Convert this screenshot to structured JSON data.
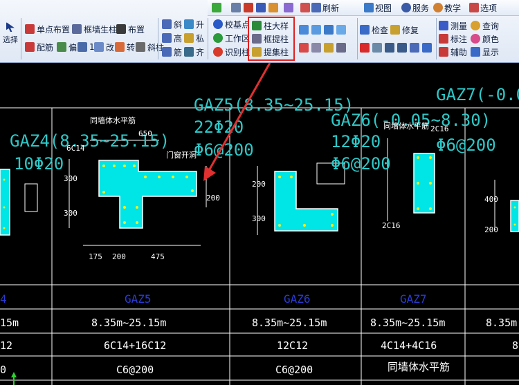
{
  "toolbar_top": {
    "refresh": "刷新",
    "view": "视图",
    "service": "服务",
    "teach": "教学",
    "options": "选项"
  },
  "ribbon": {
    "select": "选择",
    "single_point": "单点布置",
    "frame_wall_col": "框墙生柱",
    "place": "布置",
    "rebar_config": "配筋",
    "offset": "偏",
    "length_short": "1",
    "change": "改",
    "turn": "转",
    "slant_col": "斜柱",
    "slant": "斜",
    "up": "升",
    "height": "高",
    "private": "私",
    "rebar": "筋",
    "align": "齐",
    "check_base": "校基点",
    "work_zone": "工作区",
    "identify_col": "识别柱",
    "col_detail": "柱大样",
    "frame_extract_col": "框提柱",
    "extract_set": "提集柱",
    "check": "检查",
    "repair": "修复",
    "measure": "测量",
    "query": "查询",
    "annotate_col": "标注",
    "color": "颜色",
    "aux": "辅助",
    "display": "显示"
  },
  "drawing": {
    "labels_gaz": [
      "GAZ4(8.35~25.15)",
      "GAZ5(8.35~25.15)",
      "GAZ6(-0.05~8.30)",
      "GAZ7(-0.0"
    ],
    "rebar_main": [
      "10Φ20",
      "22Φ20",
      "12Φ20",
      "Φ6@200",
      "Φ6@200",
      "Φ6@200"
    ],
    "notes": [
      "同墙体水平筋",
      "门窗开洞",
      "同墙体水平筋"
    ],
    "dims": [
      "650",
      "300",
      "300",
      "200",
      "175",
      "200",
      "475",
      "200",
      "300",
      "6C14",
      "2C16",
      "2C16",
      "400",
      "200"
    ],
    "table": {
      "headers": [
        "4",
        "GAZ5",
        "GAZ6",
        "GAZ7"
      ],
      "elevation": [
        "15m",
        "8.35m~25.15m",
        "8.35m~25.15m",
        "8.35m~25.15m",
        "8.35m"
      ],
      "longitudinal": [
        "12",
        "6C14+16C12",
        "12C12",
        "4C14+4C16",
        "8"
      ],
      "stirrup": [
        "0",
        "C6@200",
        "C6@200",
        "同墙体水平筋"
      ]
    }
  },
  "colors": {
    "cyan_label": "#2ec8c8",
    "column_fill": "#00e5e5",
    "rebar": "#f0f020",
    "table_header": "#2a3cd8",
    "lines": "#ffffff",
    "arrow": "#e03030"
  }
}
